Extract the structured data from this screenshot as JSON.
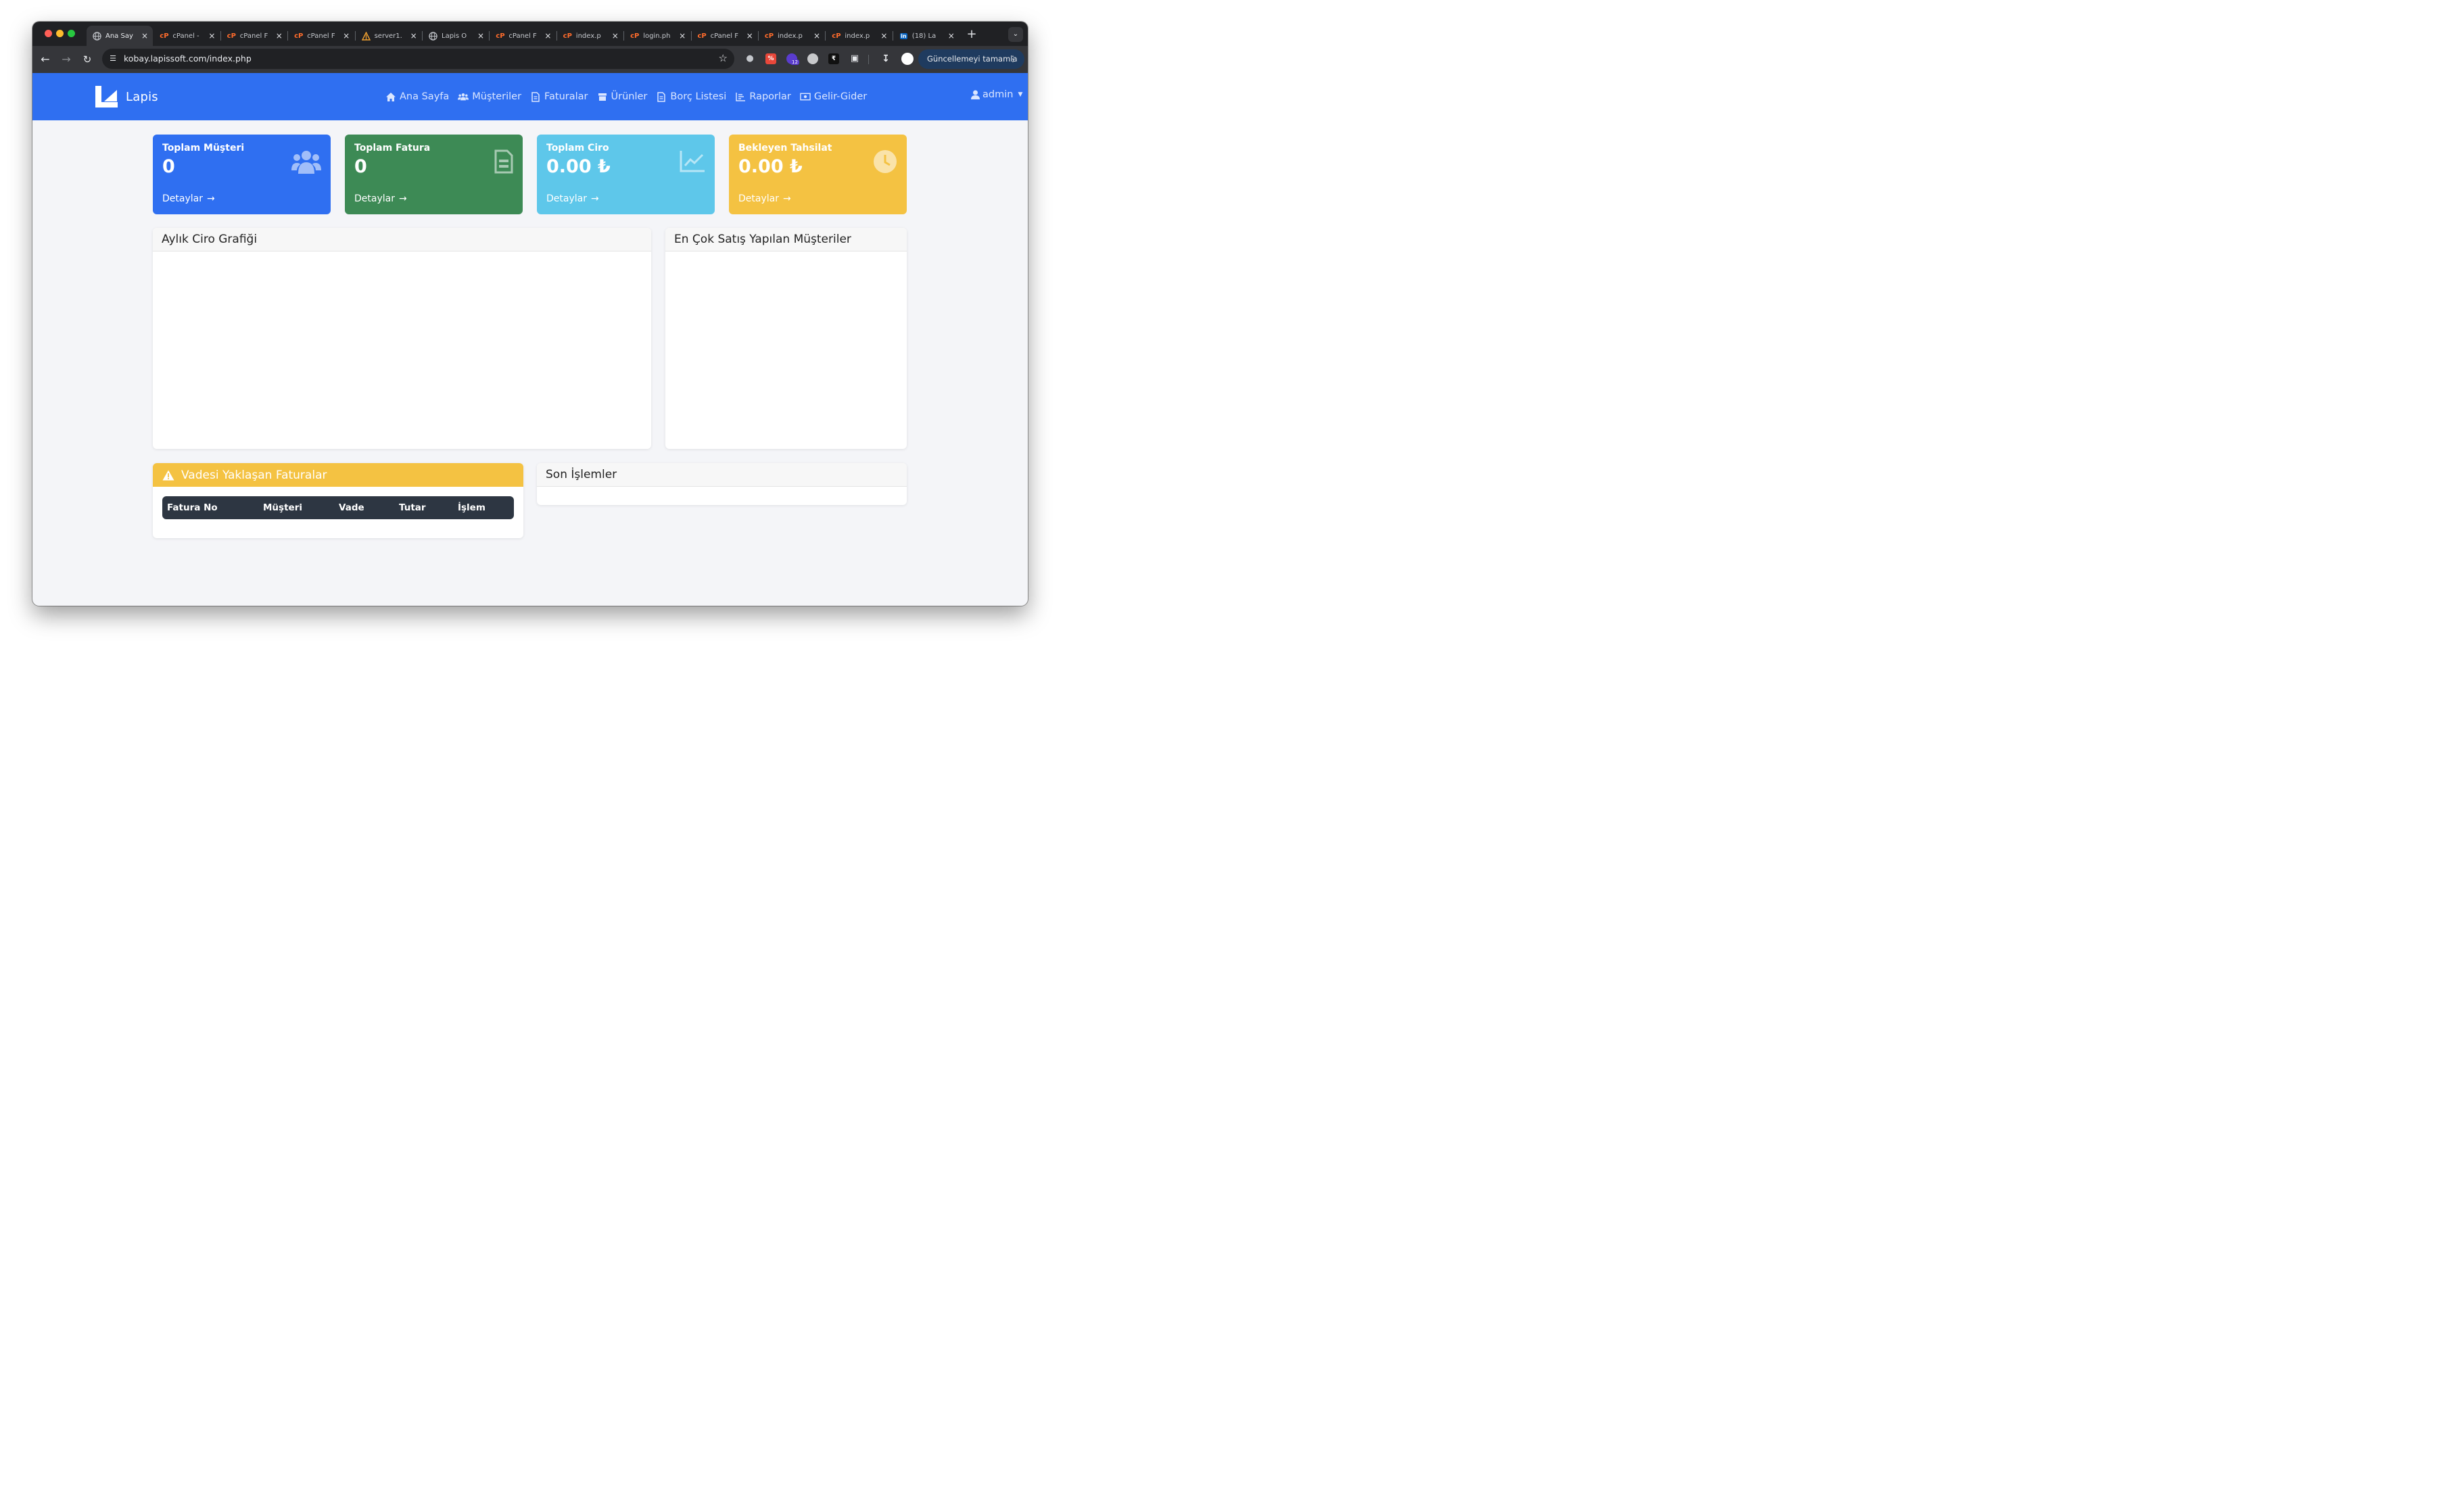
{
  "browser": {
    "tabs": [
      {
        "title": "Ana Say",
        "favicon": "globe-icon",
        "active": true
      },
      {
        "title": "cPanel -",
        "favicon": "cpanel-icon"
      },
      {
        "title": "cPanel F",
        "favicon": "cpanel-icon"
      },
      {
        "title": "cPanel F",
        "favicon": "cpanel-icon"
      },
      {
        "title": "server1.",
        "favicon": "server-icon"
      },
      {
        "title": "Lapis Ö",
        "favicon": "globe-icon"
      },
      {
        "title": "cPanel F",
        "favicon": "cpanel-icon"
      },
      {
        "title": "index.p",
        "favicon": "cpanel-icon"
      },
      {
        "title": "login.ph",
        "favicon": "cpanel-icon"
      },
      {
        "title": "cPanel F",
        "favicon": "cpanel-icon"
      },
      {
        "title": "index.p",
        "favicon": "cpanel-icon"
      },
      {
        "title": "index.p",
        "favicon": "cpanel-icon"
      },
      {
        "title": "(18) La",
        "favicon": "linkedin-icon"
      }
    ],
    "url": "kobay.lapissoft.com/index.php",
    "extension_badge": "12",
    "update_button": "Güncellemeyi tamamla"
  },
  "nav": {
    "brand": "Lapis",
    "menu": [
      {
        "label": "Ana Sayfa",
        "icon": "home-icon"
      },
      {
        "label": "Müşteriler",
        "icon": "users-icon"
      },
      {
        "label": "Faturalar",
        "icon": "file-icon"
      },
      {
        "label": "Ürünler",
        "icon": "box-icon"
      },
      {
        "label": "Borç Listesi",
        "icon": "file-icon"
      },
      {
        "label": "Raporlar",
        "icon": "chart-icon"
      },
      {
        "label": "Gelir-Gider",
        "icon": "money-icon"
      }
    ],
    "user": "admin"
  },
  "stats": [
    {
      "title": "Toplam Müşteri",
      "value": "0",
      "link": "Detaylar",
      "color": "#2f6ff1",
      "icon": "users-icon"
    },
    {
      "title": "Toplam Fatura",
      "value": "0",
      "link": "Detaylar",
      "color": "#3d8a55",
      "icon": "invoice-icon"
    },
    {
      "title": "Toplam Ciro",
      "value": "0.00 ₺",
      "link": "Detaylar",
      "color": "#5ec7ea",
      "icon": "chart-line-icon"
    },
    {
      "title": "Bekleyen Tahsilat",
      "value": "0.00 ₺",
      "link": "Detaylar",
      "color": "#f4c242",
      "icon": "clock-icon"
    }
  ],
  "panels": {
    "monthly_chart": "Aylık Ciro Grafiği",
    "top_customers": "En Çok Satış Yapılan Müşteriler",
    "upcoming_invoices": {
      "title": "Vadesi Yaklaşan Faturalar",
      "columns": [
        "Fatura No",
        "Müşteri",
        "Vade",
        "Tutar",
        "İşlem"
      ]
    },
    "recent": "Son İşlemler"
  }
}
